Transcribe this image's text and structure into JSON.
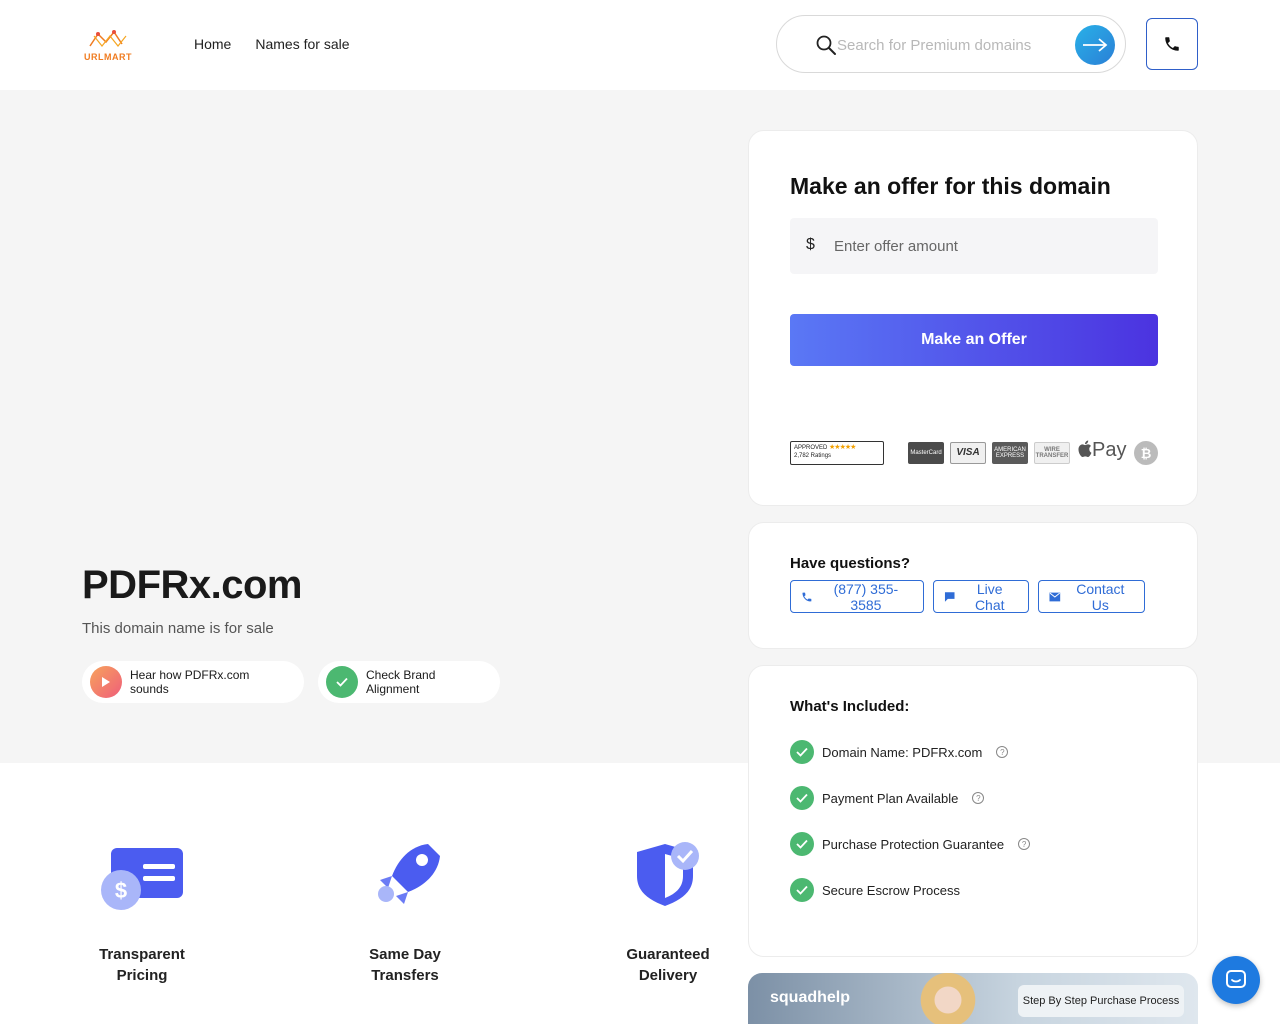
{
  "header": {
    "logo_text": "URLMART",
    "nav": [
      "Home",
      "Names for sale"
    ],
    "search_placeholder": "Search for Premium domains"
  },
  "hero": {
    "domain": "PDFRx.com",
    "subtitle": "This domain name is for sale",
    "listen_label": "Hear how PDFRx.com sounds",
    "brand_label": "Check Brand Alignment"
  },
  "offer": {
    "title": "Make an offer for this domain",
    "currency": "$",
    "placeholder": "Enter offer amount",
    "button": "Make an Offer",
    "approved_label": "APPROVED",
    "approved_stars": "★★★★★",
    "approved_ratings": "2,782 Ratings",
    "payment_methods": [
      "MasterCard",
      "VISA",
      "AMERICAN EXPRESS",
      "WIRE TRANSFER",
      "Pay",
      "₿"
    ]
  },
  "questions": {
    "title": "Have questions?",
    "phone": "(877) 355-3585",
    "chat": "Live Chat",
    "contact": "Contact Us"
  },
  "included": {
    "title": "What's Included:",
    "items": [
      "Domain Name: PDFRx.com",
      "Payment Plan Available",
      "Purchase Protection Guarantee",
      "Secure Escrow Process"
    ]
  },
  "features": [
    {
      "line1": "Transparent",
      "line2": "Pricing"
    },
    {
      "line1": "Same Day",
      "line2": "Transfers"
    },
    {
      "line1": "Guaranteed",
      "line2": "Delivery"
    }
  ],
  "video": {
    "logo": "squadhelp",
    "badge": "Step By Step Purchase Process"
  },
  "colors": {
    "accent_blue": "#2f6cd6",
    "cta_gradient_start": "#5a78f5",
    "cta_gradient_end": "#4b33e0",
    "check_green": "#4cb871",
    "hero_bg": "#f5f5f5"
  }
}
